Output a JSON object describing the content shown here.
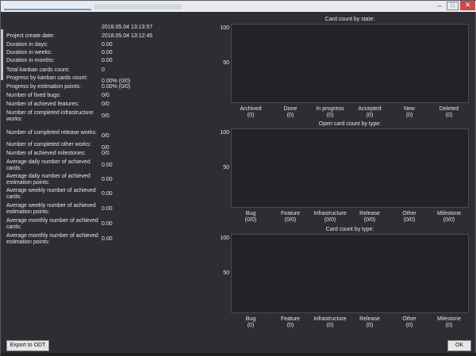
{
  "window": {
    "buttons": {
      "minimize": "–",
      "maximize": "□",
      "close": "✕"
    }
  },
  "stats": {
    "header_value": "2018.05.04 13:13:57",
    "rows": [
      {
        "label": "Project create date:",
        "value": "2018.05.04 13:12:45"
      },
      {
        "label": "Duration in days:",
        "value": "0.00"
      },
      {
        "label": "Duration in weeks:",
        "value": "0.00"
      },
      {
        "label": "Duration in months:",
        "value": "0.00"
      },
      {
        "label": "Total kanban cards count:",
        "value": "0"
      },
      {
        "label": "Progress by kanban cards count:",
        "value": "0.00% (0/0)"
      },
      {
        "label": "Progress by estimation points:",
        "value": "0.00% (0/0)"
      },
      {
        "label": "Number of fixed bugs:",
        "value": "0/0"
      },
      {
        "label": "Number of achieved features:",
        "value": "0/0"
      },
      {
        "label": "Number of completed infrastructure works:",
        "value": "0/0"
      },
      {
        "label": "Number of completed release works:",
        "value": "0/0"
      },
      {
        "label": "Number of completed other works:",
        "value": "0/0"
      },
      {
        "label": "Number of achieved milestones:",
        "value": "0/0"
      },
      {
        "label": "Average daily number of achieved cards:",
        "value": "0.00"
      },
      {
        "label": "Average daily number of achieved estimation points:",
        "value": "0.00"
      },
      {
        "label": "Average weekly number of achieved cards:",
        "value": "0.00"
      },
      {
        "label": "Average weekly number of achieved estimation points:",
        "value": "0.00"
      },
      {
        "label": "Average monthly number of achieved cards:",
        "value": "0.00"
      },
      {
        "label": "Average monthly number of achieved estimation points:",
        "value": "0.00"
      }
    ]
  },
  "chart_data": [
    {
      "type": "bar",
      "title": "Card count by state:",
      "categories": [
        "Archived",
        "Done",
        "In progress",
        "Accepted",
        "New",
        "Deleted"
      ],
      "category_values": [
        "(0)",
        "(0)",
        "(0)",
        "(0)",
        "(0)",
        "(0)"
      ],
      "values": [
        0,
        0,
        0,
        0,
        0,
        0
      ],
      "yticks": [
        "100",
        "50"
      ],
      "ylim": [
        0,
        100
      ]
    },
    {
      "type": "bar",
      "title": "Open card count by type:",
      "categories": [
        "Bug",
        "Feature",
        "Infrastructure",
        "Release",
        "Other",
        "Milestone"
      ],
      "category_values": [
        "(0/0)",
        "(0/0)",
        "(0/0)",
        "(0/0)",
        "(0/0)",
        "(0/0)"
      ],
      "values": [
        0,
        0,
        0,
        0,
        0,
        0
      ],
      "yticks": [
        "100",
        "50"
      ],
      "ylim": [
        0,
        100
      ]
    },
    {
      "type": "bar",
      "title": "Card count by type:",
      "categories": [
        "Bug",
        "Feature",
        "Infrastructure",
        "Release",
        "Other",
        "Milestone"
      ],
      "category_values": [
        "(0)",
        "(0)",
        "(0)",
        "(0)",
        "(0)",
        "(0)"
      ],
      "values": [
        0,
        0,
        0,
        0,
        0,
        0
      ],
      "yticks": [
        "100",
        "50"
      ],
      "ylim": [
        0,
        100
      ]
    }
  ],
  "buttons": {
    "export": "Export to ODT",
    "ok": "OK"
  }
}
